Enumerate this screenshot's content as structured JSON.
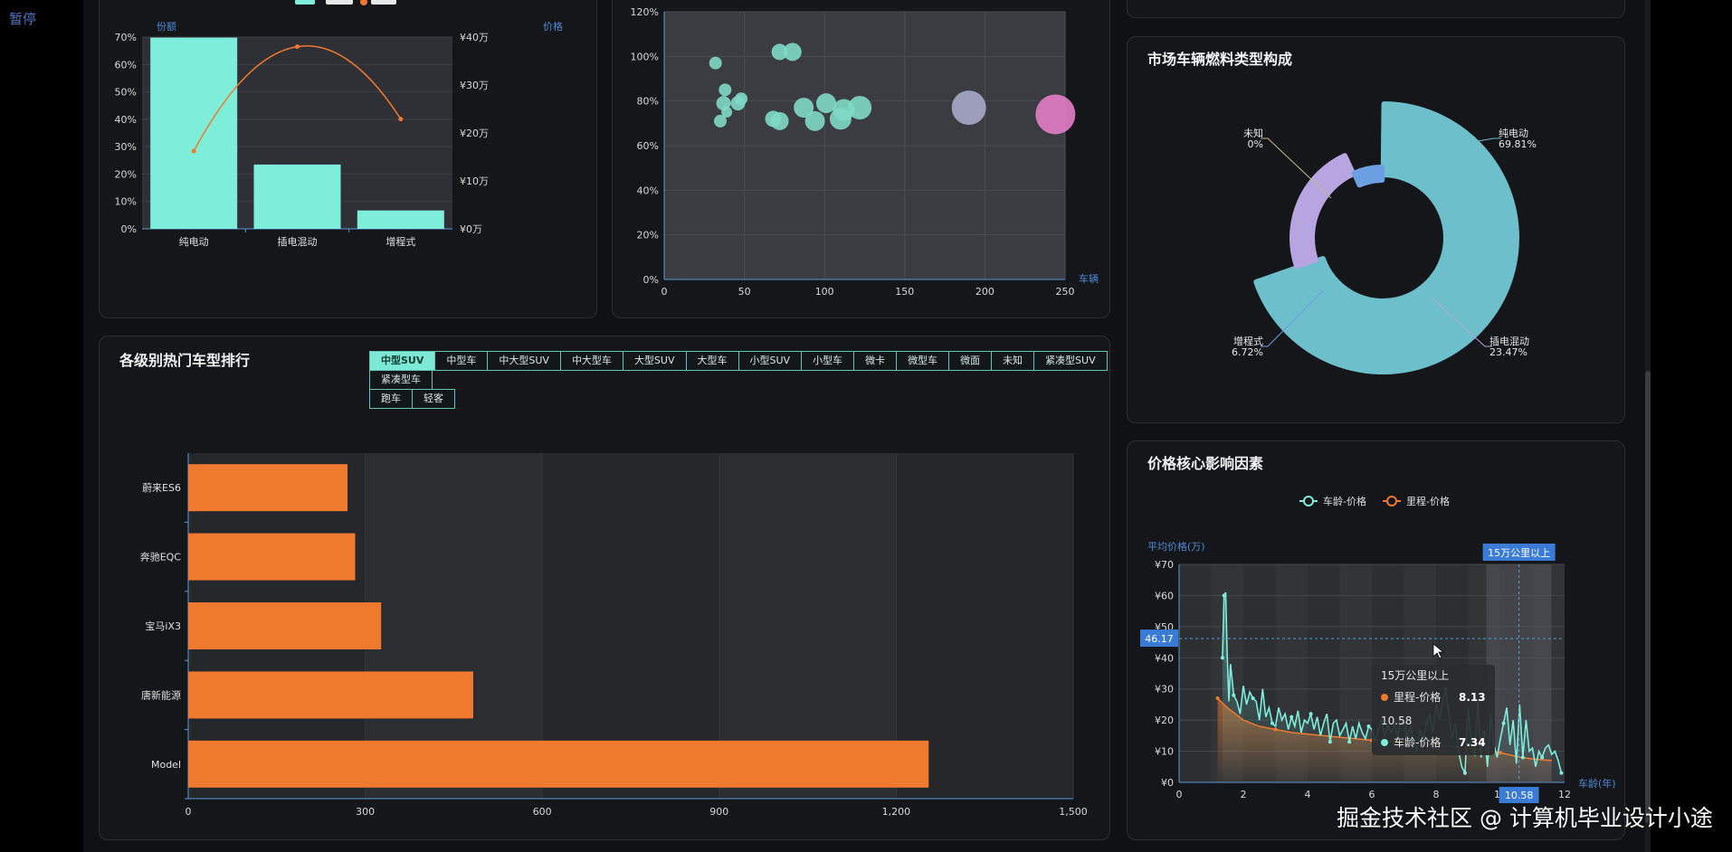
{
  "status": {
    "pause_label": "暂停"
  },
  "watermark": "掘金技术社区 @ 计算机毕业设计小途",
  "colors": {
    "teal": "#7eeedb",
    "orange": "#ef7a2e",
    "bubble_teal": "#7fd9c4",
    "bubble_gray": "#a7a8c9",
    "bubble_pink": "#e47dc8",
    "tab_border": "#5fc7b3"
  },
  "charts": {
    "fuel_share": {
      "axis_left_name": "份额",
      "axis_right_name": "价格",
      "y_left_ticks": [
        "0%",
        "10%",
        "20%",
        "30%",
        "40%",
        "50%",
        "60%",
        "70%"
      ],
      "y_right_ticks": [
        "¥0万",
        "¥10万",
        "¥20万",
        "¥30万",
        "¥40万"
      ]
    },
    "scatter": {
      "y_ticks": [
        "0%",
        "20%",
        "40%",
        "60%",
        "80%",
        "100%",
        "120%"
      ],
      "x_ticks": [
        "0",
        "50",
        "100",
        "150",
        "200",
        "250"
      ],
      "x_axis_name": "车辆"
    },
    "ranking": {
      "title": "各级别热门车型排行",
      "x_ticks": [
        "0",
        "300",
        "600",
        "900",
        "1,200",
        "1,500"
      ]
    },
    "donut": {
      "title": "市场车辆燃料类型构成"
    },
    "factors": {
      "title": "价格核心影响因素",
      "legend": [
        {
          "name": "车龄-价格",
          "color": "#7eeedb"
        },
        {
          "name": "里程-价格",
          "color": "#ef7a2e"
        }
      ],
      "y_axis_name": "平均价格(万)",
      "x_axis_name": "车龄(年)",
      "y_ticks": [
        "¥0",
        "¥10",
        "¥20",
        "¥30",
        "¥40",
        "¥50",
        "¥60",
        "¥70"
      ],
      "x_ticks": [
        "0",
        "2",
        "4",
        "6",
        "8",
        "10",
        "12"
      ],
      "crosshair_y_label": "46.17",
      "crosshair_x_label": "10.58",
      "crosshair_top_label": "15万公里以上",
      "tooltip": {
        "group1_title": "15万公里以上",
        "group1_series": "里程-价格",
        "group1_value": "8.13",
        "group2_title": "10.58",
        "group2_series": "车龄-价格",
        "group2_value": "7.34"
      }
    }
  },
  "ranking_tabs": [
    "中型SUV",
    "中型车",
    "中大型SUV",
    "中大型车",
    "大型SUV",
    "大型车",
    "小型SUV",
    "小型车",
    "微卡",
    "微型车",
    "微面",
    "未知",
    "紧凑型SUV",
    "紧凑型车",
    "跑车",
    "轻客"
  ],
  "chart_data": [
    {
      "type": "bar",
      "id": "fuel_share",
      "categories": [
        "纯电动",
        "插电混动",
        "增程式"
      ],
      "series": [
        {
          "type": "bar",
          "axis": "left",
          "values": [
            69.81,
            23.47,
            6.72
          ]
        },
        {
          "type": "line",
          "axis": "right",
          "values": [
            16.2,
            38.0,
            22.9
          ]
        }
      ],
      "ylim_left": [
        0,
        70
      ],
      "ylim_right": [
        0,
        40
      ],
      "grid": true
    },
    {
      "type": "scatter",
      "id": "scatter",
      "xlim": [
        0,
        250
      ],
      "ylim": [
        0,
        120
      ],
      "points": [
        {
          "x": 32,
          "y": 97,
          "r": 7,
          "color": "#7fd9c4"
        },
        {
          "x": 35,
          "y": 71,
          "r": 7,
          "color": "#7fd9c4"
        },
        {
          "x": 37,
          "y": 79,
          "r": 8,
          "color": "#7fd9c4"
        },
        {
          "x": 39,
          "y": 75,
          "r": 6,
          "color": "#7fd9c4"
        },
        {
          "x": 38,
          "y": 85,
          "r": 7,
          "color": "#7fd9c4"
        },
        {
          "x": 46,
          "y": 79,
          "r": 8,
          "color": "#7fd9c4"
        },
        {
          "x": 48,
          "y": 81,
          "r": 7,
          "color": "#7fd9c4"
        },
        {
          "x": 72,
          "y": 102,
          "r": 9,
          "color": "#7fd9c4"
        },
        {
          "x": 80,
          "y": 102,
          "r": 10,
          "color": "#7fd9c4"
        },
        {
          "x": 68,
          "y": 72,
          "r": 9,
          "color": "#7fd9c4"
        },
        {
          "x": 72,
          "y": 71,
          "r": 10,
          "color": "#7fd9c4"
        },
        {
          "x": 87,
          "y": 77,
          "r": 11,
          "color": "#7fd9c4"
        },
        {
          "x": 94,
          "y": 71,
          "r": 11,
          "color": "#7fd9c4"
        },
        {
          "x": 101,
          "y": 79,
          "r": 11,
          "color": "#7fd9c4"
        },
        {
          "x": 110,
          "y": 72,
          "r": 12,
          "color": "#7fd9c4"
        },
        {
          "x": 112,
          "y": 76,
          "r": 12,
          "color": "#7fd9c4"
        },
        {
          "x": 122,
          "y": 77,
          "r": 13,
          "color": "#7fd9c4"
        },
        {
          "x": 190,
          "y": 77,
          "r": 19,
          "color": "#a7a8c9"
        },
        {
          "x": 244,
          "y": 74,
          "r": 22,
          "color": "#e47dc8"
        }
      ],
      "grid": true
    },
    {
      "type": "bar",
      "id": "ranking",
      "orientation": "horizontal",
      "categories": [
        "Model",
        "唐新能源",
        "宝马iX3",
        "奔驰EQC",
        "蔚来ES6"
      ],
      "values": [
        1255,
        483,
        327,
        283,
        270
      ],
      "xlim": [
        0,
        1500
      ],
      "grid": true
    },
    {
      "type": "pie",
      "id": "donut",
      "labels": [
        "纯电动",
        "插电混动",
        "增程式",
        "未知"
      ],
      "values": [
        69.81,
        23.47,
        6.72,
        0
      ],
      "label_text": [
        "69.81%",
        "23.47%",
        "6.72%",
        "0%"
      ],
      "colors": [
        "#6ebfcc",
        "#b6a5e0",
        "#6d9fe3",
        "#c9b98c"
      ],
      "rose": true
    },
    {
      "type": "line",
      "id": "factors",
      "xlim": [
        0,
        12
      ],
      "ylim": [
        0,
        70
      ],
      "series": [
        {
          "name": "车龄-价格",
          "x": [
            1.35,
            1.4,
            1.45,
            1.5,
            1.55,
            1.6,
            1.7,
            1.8,
            1.9,
            2.0,
            2.1,
            2.2,
            2.3,
            2.4,
            2.5,
            2.6,
            2.7,
            2.8,
            2.9,
            3.0,
            3.1,
            3.2,
            3.3,
            3.4,
            3.5,
            3.6,
            3.7,
            3.8,
            3.9,
            4.0,
            4.1,
            4.2,
            4.3,
            4.4,
            4.5,
            4.6,
            4.7,
            4.8,
            4.9,
            5.0,
            5.1,
            5.2,
            5.3,
            5.4,
            5.5,
            5.6,
            5.7,
            5.8,
            5.9,
            6.0,
            6.1,
            6.2,
            6.3,
            6.4,
            6.5,
            6.6,
            6.7,
            6.8,
            6.9,
            7.0,
            7.1,
            7.2,
            7.3,
            7.4,
            7.5,
            7.6,
            7.7,
            7.8,
            7.9,
            8.0,
            8.1,
            8.2,
            8.3,
            8.4,
            8.5,
            8.6,
            8.7,
            8.8,
            8.9,
            9.0,
            9.1,
            9.2,
            9.3,
            9.4,
            9.5,
            9.6,
            9.7,
            9.8,
            9.9,
            10.0,
            10.1,
            10.2,
            10.3,
            10.4,
            10.5,
            10.6,
            10.7,
            10.8,
            10.9,
            11.0,
            11.1,
            11.2,
            11.3,
            11.4,
            11.5,
            11.6,
            11.7,
            11.8,
            11.9
          ],
          "y": [
            40,
            60,
            61,
            40,
            26,
            38,
            28,
            26,
            22,
            31,
            25,
            29,
            27,
            26,
            20,
            30,
            21,
            24,
            19,
            18,
            24,
            20,
            22,
            17,
            21,
            18,
            23,
            16,
            20,
            19,
            22,
            17,
            21,
            15,
            19,
            22,
            13,
            19,
            20,
            15,
            17,
            19,
            13,
            18,
            14,
            19,
            16,
            14,
            18,
            17,
            13,
            17,
            20,
            15,
            18,
            16,
            19,
            14,
            21,
            20,
            15,
            18,
            13,
            10,
            17,
            14,
            19,
            22,
            16,
            25,
            20,
            26,
            30,
            22,
            14,
            19,
            10,
            5,
            3,
            24,
            11,
            9,
            26,
            8,
            16,
            5,
            22,
            12,
            8,
            14,
            19,
            24,
            12,
            20,
            6,
            25,
            8,
            20,
            10,
            11,
            5,
            10,
            8,
            11,
            12,
            9,
            10,
            7,
            3
          ]
        },
        {
          "name": "里程-价格",
          "x": [
            1.2,
            1.5,
            2.0,
            2.5,
            3.0,
            3.5,
            4.0,
            5.0,
            6.0,
            7.0,
            8.0,
            9.0,
            10.0,
            10.58,
            11.0,
            11.6
          ],
          "y": [
            27,
            24,
            20,
            18,
            17,
            16,
            15.5,
            14.5,
            13.5,
            13,
            12,
            11,
            9.5,
            8.13,
            7.5,
            7
          ]
        }
      ],
      "crosshair": {
        "x": 10.58,
        "y": 46.17
      },
      "grid": true
    }
  ]
}
